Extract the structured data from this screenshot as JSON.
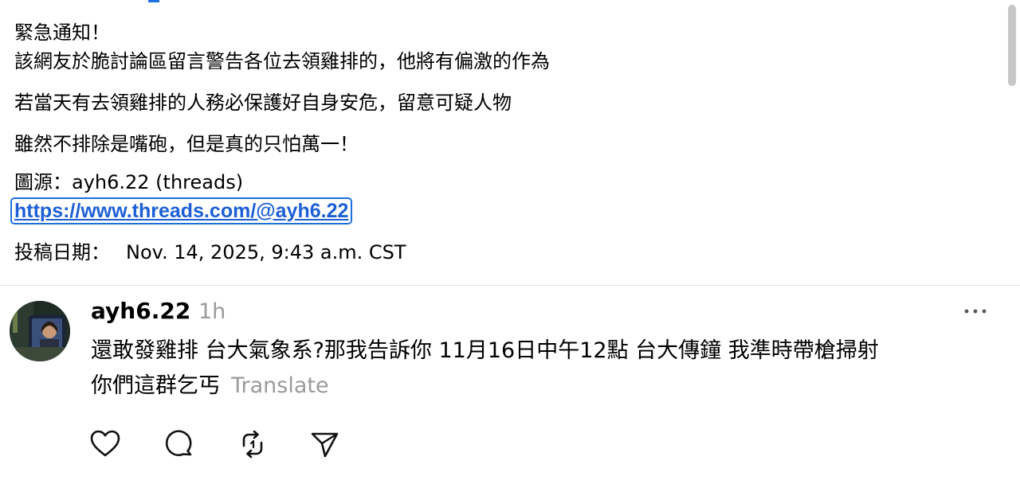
{
  "post": {
    "lines": [
      "緊急通知！",
      "該網友於脆討論區留言警告各位去領雞排的，他將有偏激的作為",
      "若當天有去領雞排的人務必保護好自身安危，留意可疑人物",
      "雖然不排除是嘴砲，但是真的只怕萬一！",
      "圖源：ayh6.22 (threads)"
    ],
    "link": "https://www.threads.com/@ayh6.22",
    "submitted_label": "投稿日期：",
    "submitted_date": "Nov. 14, 2025, 9:43 a.m. CST"
  },
  "reply": {
    "username": "ayh6.22",
    "timestamp": "1h",
    "text_line_1": "還敢發雞排 台大氣象系?那我告訴你 11月16日中午12點 台大傳鐘 我準時帶槍掃射",
    "text_line_2": "你們這群乞丐",
    "translate_label": "Translate"
  },
  "icons": {
    "more": "more-horizontal-icon",
    "like": "heart-icon",
    "comment": "comment-bubble-icon",
    "repost": "repost-icon",
    "share": "send-icon"
  },
  "colors": {
    "link": "#1d5fd6",
    "link_focus_border": "#1d6fe0",
    "muted_text": "#9a9a9a",
    "divider": "#e2e2e2"
  }
}
